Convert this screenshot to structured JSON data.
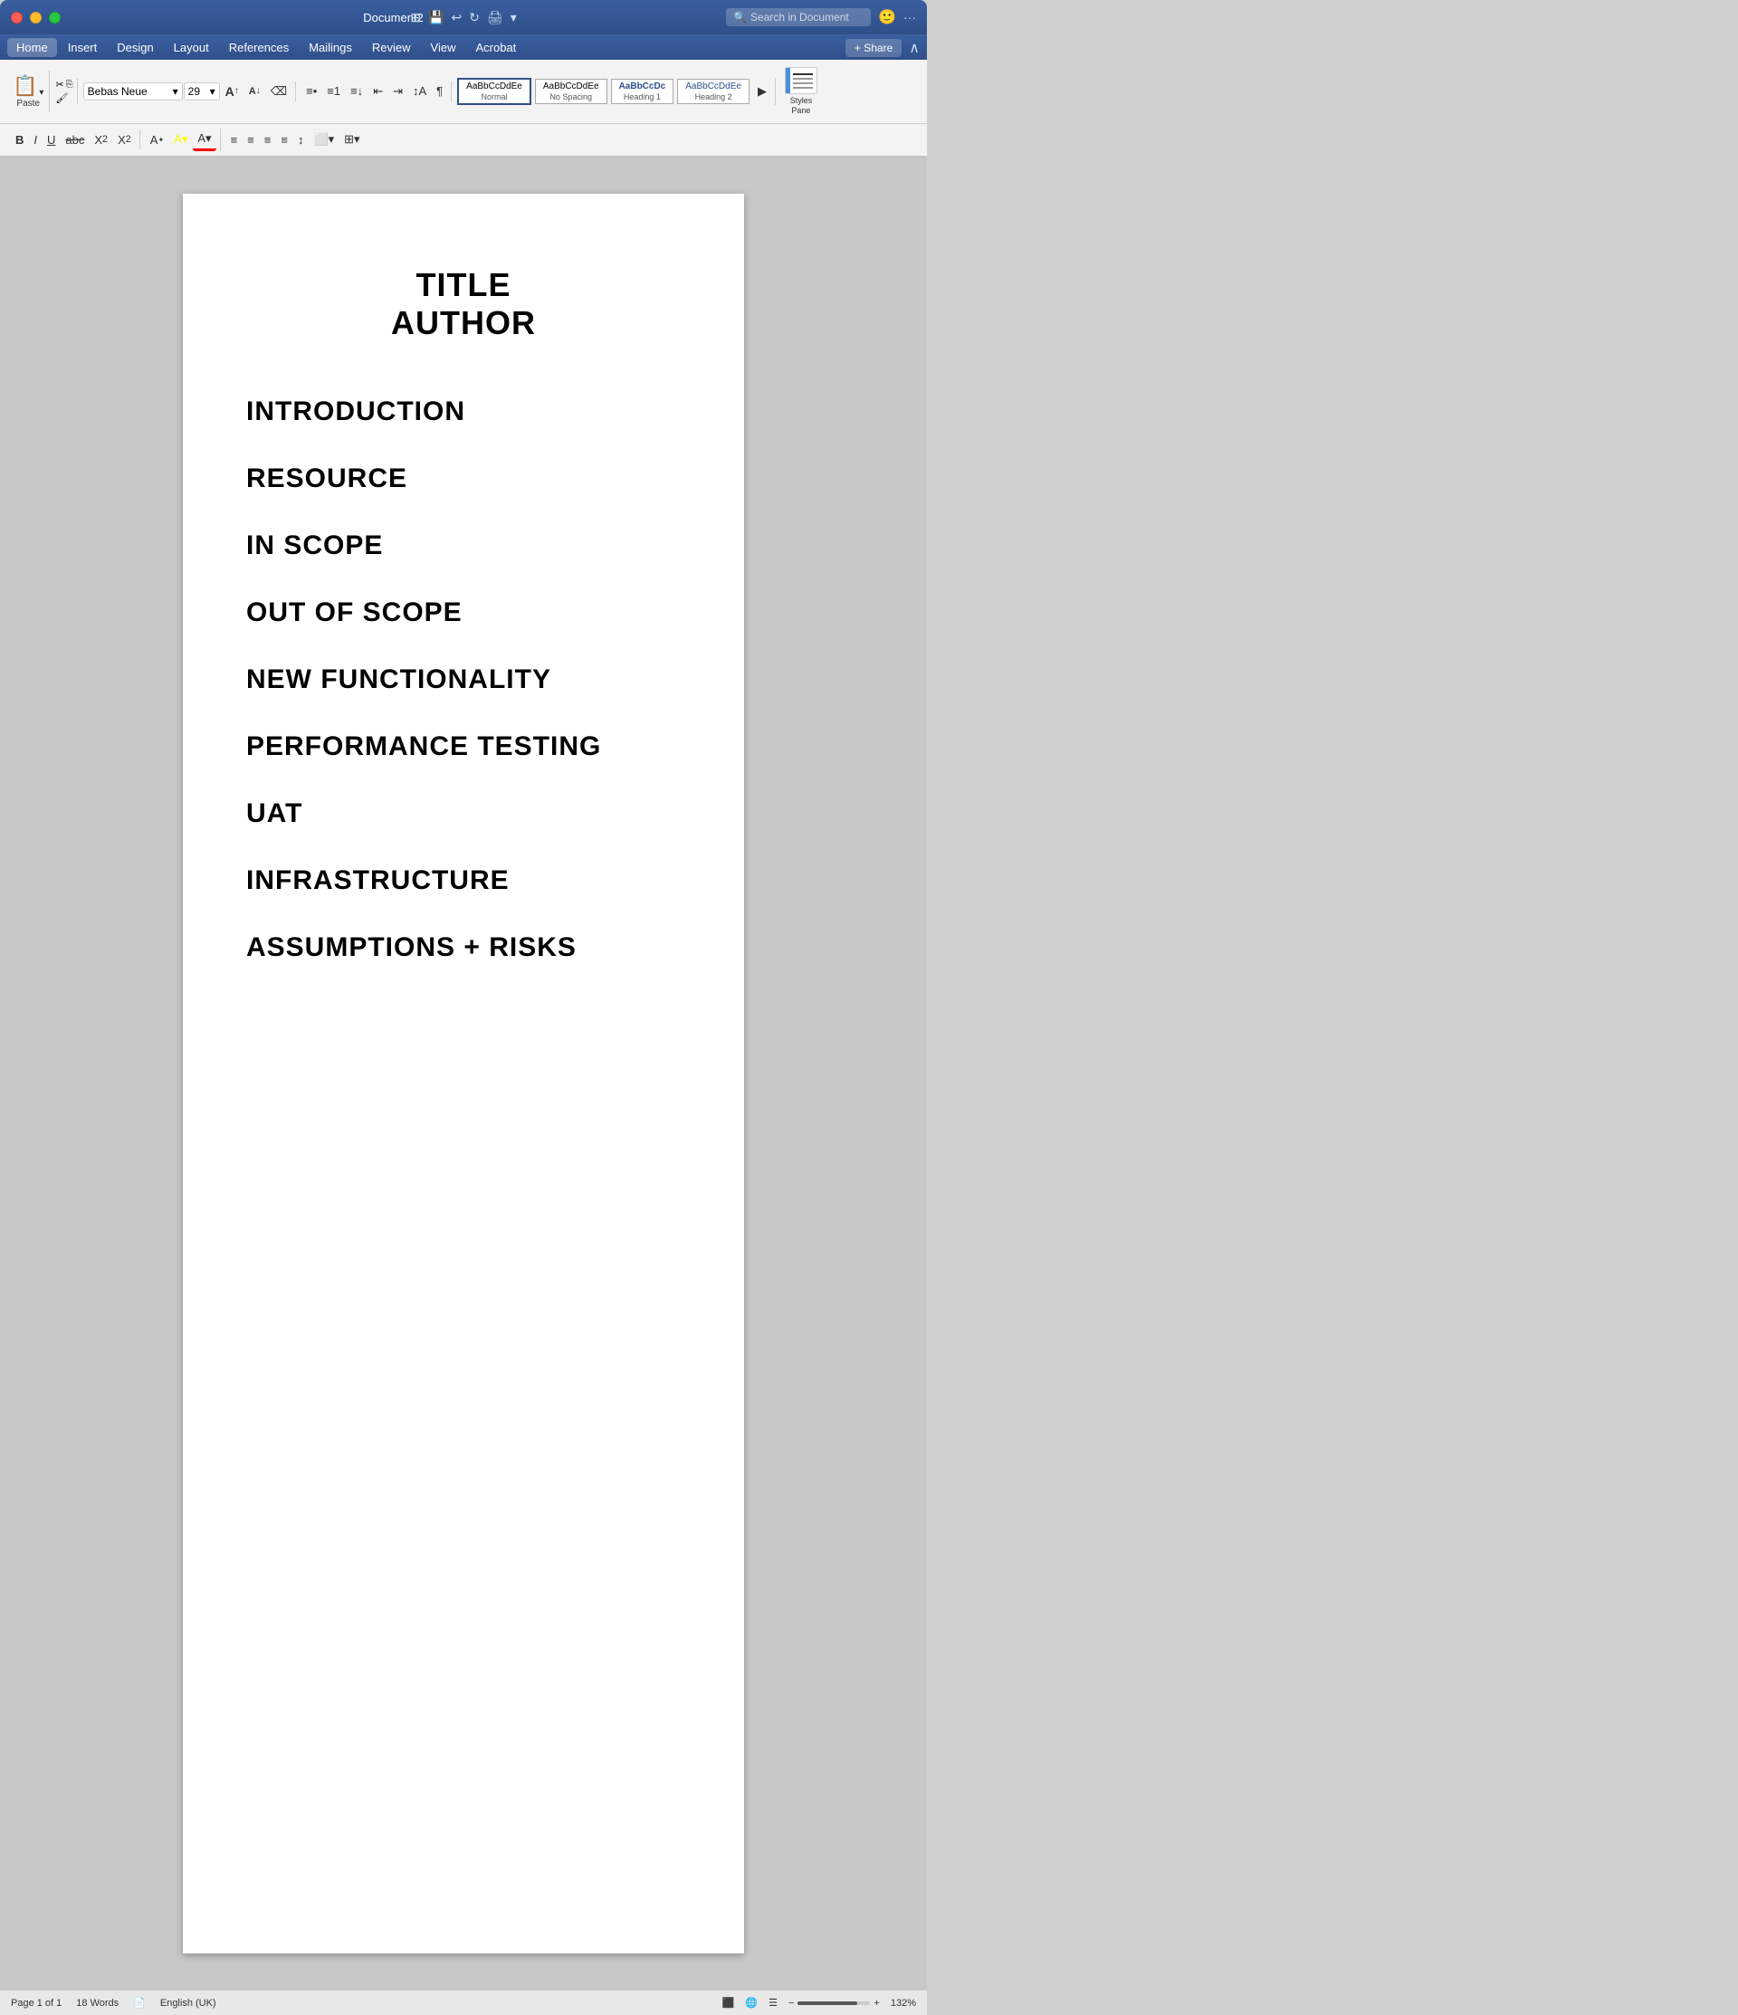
{
  "window": {
    "title": "Document2",
    "traffic_lights": [
      "close",
      "minimize",
      "maximize"
    ]
  },
  "title_bar": {
    "title": "Document2",
    "search_placeholder": "Search in Document",
    "icons": [
      "grid",
      "save",
      "undo-undo",
      "refresh",
      "print",
      "expand"
    ]
  },
  "menu_bar": {
    "items": [
      "Home",
      "Insert",
      "Design",
      "Layout",
      "References",
      "Mailings",
      "Review",
      "View",
      "Acrobat"
    ],
    "active": "Home",
    "share": "+ Share"
  },
  "toolbar": {
    "font": "Bebas Neue",
    "font_size": "29",
    "paste_label": "Paste",
    "format_buttons": [
      "B",
      "I",
      "U",
      "abc",
      "X₂",
      "X²"
    ],
    "styles": [
      {
        "label": "AaBbCcDdEe",
        "style_name": "Normal",
        "active": true
      },
      {
        "label": "AaBbCcDdEe",
        "style_name": "No Spacing",
        "active": false
      },
      {
        "label": "AaBbCcDc",
        "style_name": "Heading 1",
        "active": false
      },
      {
        "label": "AaBbCcDdEe",
        "style_name": "Heading 2",
        "active": false
      }
    ],
    "styles_pane_label": "Styles\nPane"
  },
  "document": {
    "title": "TITLE",
    "author": "AUTHOR",
    "headings": [
      "INTRODUCTION",
      "RESOURCE",
      "IN SCOPE",
      "OUT OF SCOPE",
      "NEW FUNCTIONALITY",
      "PERFORMANCE TESTING",
      "UAT",
      "INFRASTRUCTURE",
      "ASSUMPTIONS + RISKS"
    ]
  },
  "status_bar": {
    "page": "Page 1 of 1",
    "words": "18 Words",
    "language": "English (UK)",
    "zoom": "132%",
    "zoom_value": 82
  }
}
